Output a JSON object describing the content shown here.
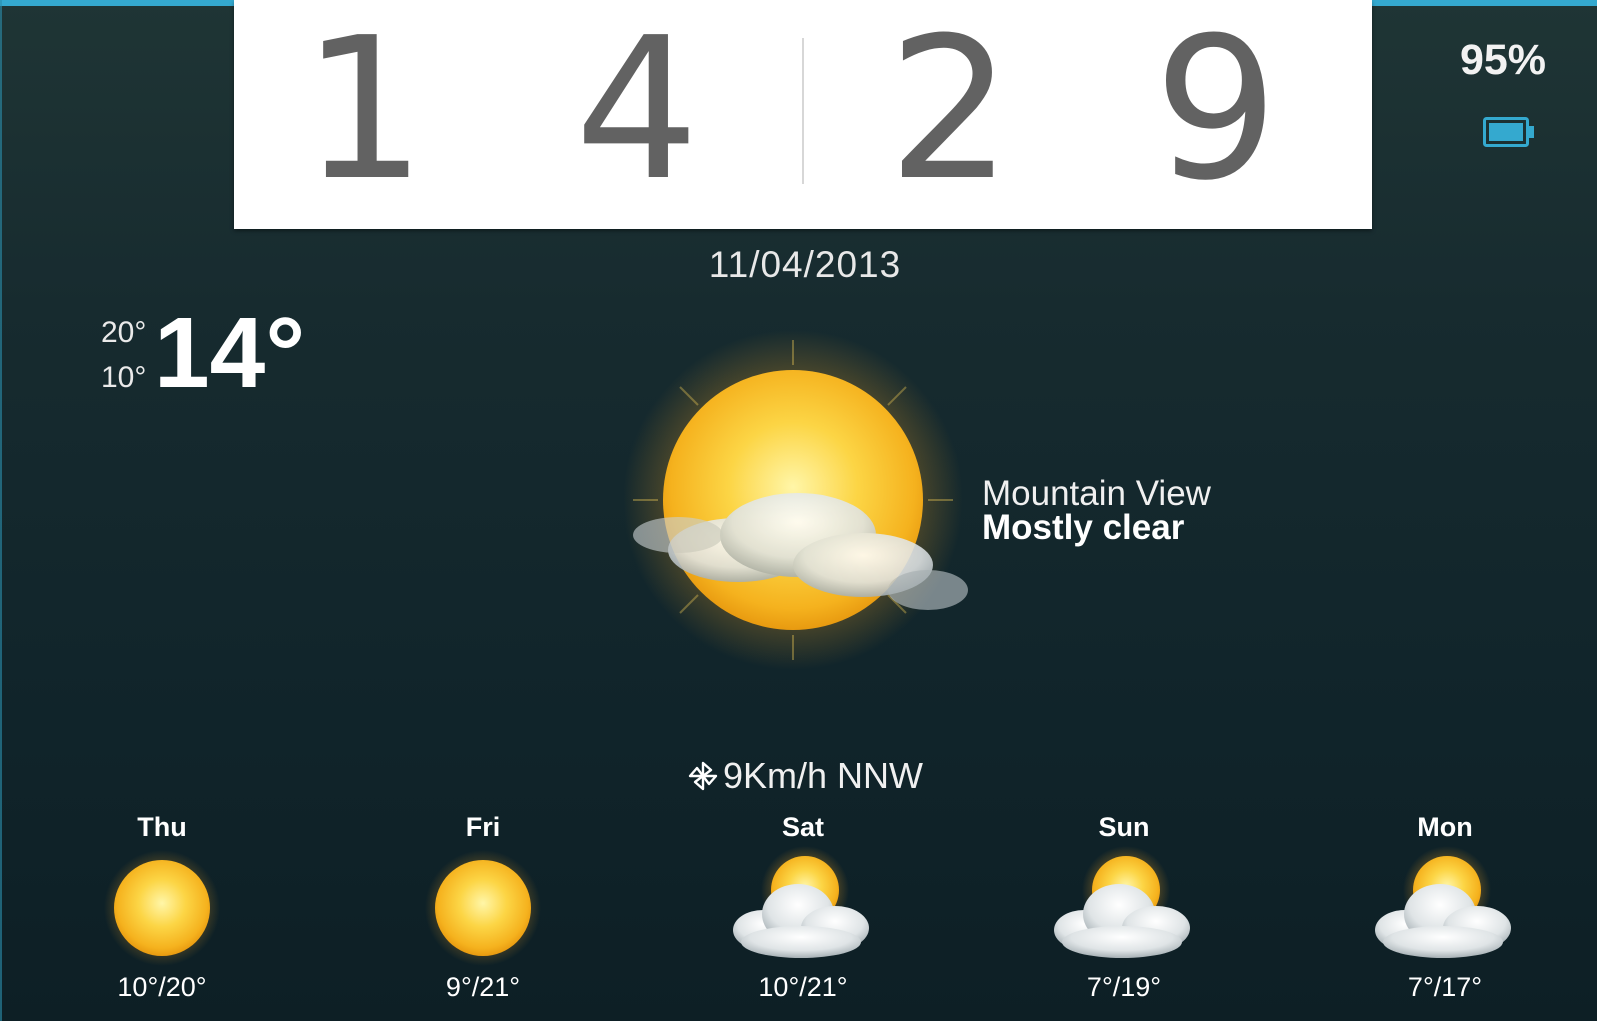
{
  "clock": {
    "digits": [
      "1",
      "4",
      "2",
      "9"
    ]
  },
  "battery": {
    "percent_label": "95%",
    "icon": "battery-icon",
    "color": "#34a9cf"
  },
  "date": "11/04/2013",
  "temperature": {
    "high": "20°",
    "low": "10°",
    "current": "14°"
  },
  "current_weather": {
    "icon": "sun-cloud-icon",
    "location": "Mountain View",
    "condition": "Mostly clear"
  },
  "wind": {
    "icon": "pinwheel-icon",
    "text": "9Km/h NNW"
  },
  "forecast": [
    {
      "day": "Thu",
      "icon": "sun-icon",
      "temps": "10°/20°"
    },
    {
      "day": "Fri",
      "icon": "sun-icon",
      "temps": "9°/21°"
    },
    {
      "day": "Sat",
      "icon": "partly-cloudy-icon",
      "temps": "10°/21°"
    },
    {
      "day": "Sun",
      "icon": "partly-cloudy-icon",
      "temps": "7°/19°"
    },
    {
      "day": "Mon",
      "icon": "partly-cloudy-icon",
      "temps": "7°/17°"
    }
  ],
  "colors": {
    "accent": "#34a9cf",
    "clock_digit": "#626262",
    "sun": "#f7c22b"
  }
}
